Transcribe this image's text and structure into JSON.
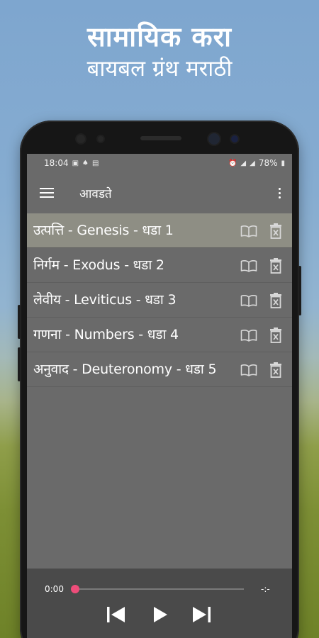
{
  "promo": {
    "line1": "सामायिक करा",
    "line2": "बायबल ग्रंथ मराठी"
  },
  "status_bar": {
    "time": "18:04",
    "battery": "78%"
  },
  "app_bar": {
    "title": "आवडते",
    "menu_icon": "hamburger-menu-icon",
    "overflow_icon": "more-vert-icon"
  },
  "favorites": [
    {
      "label": "उत्पत्ति - Genesis - धडा 1",
      "selected": true
    },
    {
      "label": "निर्गम - Exodus - धडा 2",
      "selected": false
    },
    {
      "label": "लेवीय - Leviticus - धडा 3",
      "selected": false
    },
    {
      "label": "गणना - Numbers - धडा 4",
      "selected": false
    },
    {
      "label": "अनुवाद - Deuteronomy - धडा 5",
      "selected": false
    }
  ],
  "row_icons": {
    "open": "open-book-icon",
    "delete": "delete-icon"
  },
  "player": {
    "current_time": "0:00",
    "total_time": "-:-",
    "progress": 0,
    "accent_color": "#ee4d7a"
  },
  "colors": {
    "screen_bg": "#6a6a6a",
    "selected_row": "#8e8e84",
    "player_bg": "#4a4a4a"
  }
}
